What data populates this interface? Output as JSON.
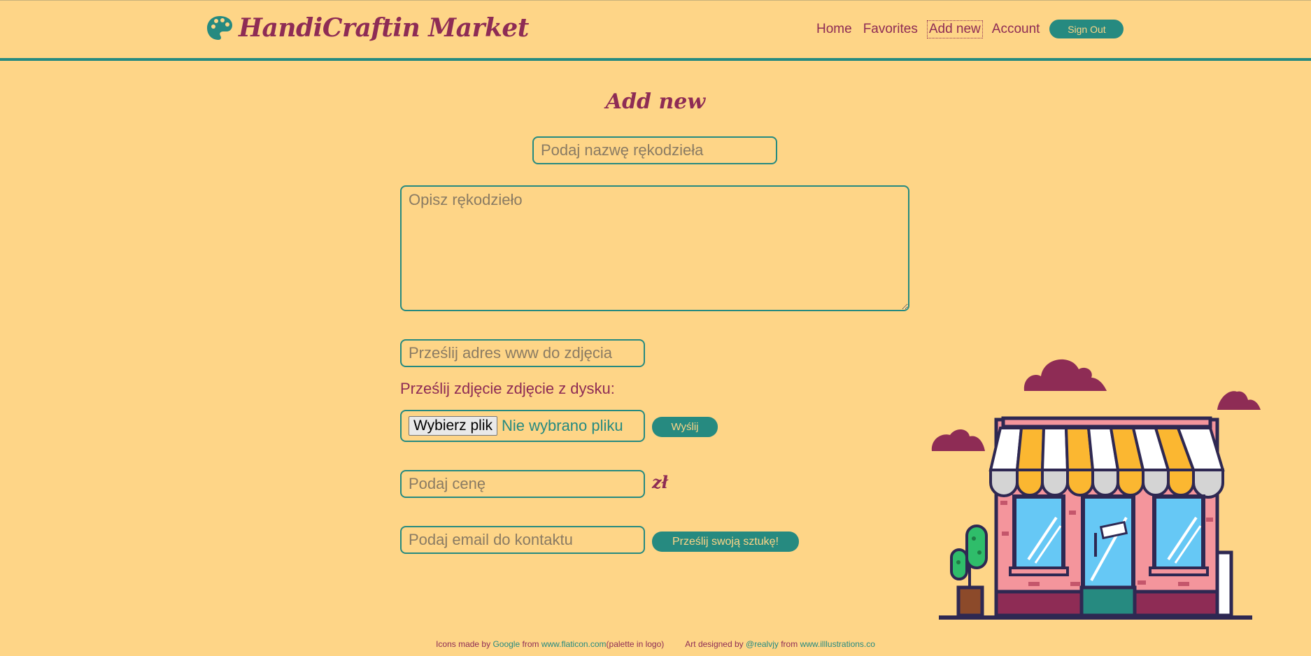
{
  "header": {
    "logo_icon": "palette-icon",
    "title": "HandiCraftin Market",
    "nav": [
      {
        "label": "Home"
      },
      {
        "label": "Favorites"
      },
      {
        "label": "Add new"
      },
      {
        "label": "Account"
      }
    ],
    "sign_out": "Sign Out"
  },
  "page": {
    "title": "Add new"
  },
  "form": {
    "name_placeholder": "Podaj nazwę rękodzieła",
    "description_placeholder": "Opisz rękodzieło",
    "url_placeholder": "Prześlij adres www do zdjęcia",
    "disk_label": "Prześlij zdjęcie zdjęcie z dysku:",
    "file_button": "Wybierz plik",
    "file_status": "Nie wybrano pliku",
    "upload_button": "Wyślij",
    "price_placeholder": "Podaj cenę",
    "currency": "zł",
    "email_placeholder": "Podaj email do kontaktu",
    "submit_button": "Prześlij swoją sztukę!"
  },
  "footer": {
    "icons_prefix": "Icons made by",
    "icons_author": "Google",
    "from1": "from",
    "icons_site": "www.flaticon.com",
    "icons_note": "(palette in logo)",
    "art_prefix": "Art designed by",
    "art_author": "@realvjy",
    "from2": "from",
    "art_site": "www.illlustrations.co"
  },
  "colors": {
    "background": "#fed587",
    "primary": "#268a80",
    "accent": "#8e2c55"
  }
}
